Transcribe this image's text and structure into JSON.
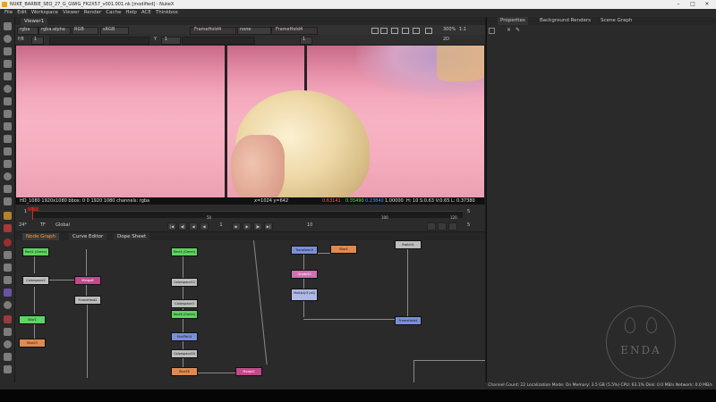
{
  "window": {
    "title": "NUKE_BARBIE_SEQ_27_G_GWIG_FK2X57_v001.001.nk [modified] - NukeX",
    "minimize_glyph": "–",
    "maximize_glyph": "□",
    "close_glyph": "×"
  },
  "menu": [
    "File",
    "Edit",
    "Workspace",
    "Viewer",
    "Render",
    "Cache",
    "Help",
    "ACE",
    "Thinkbox"
  ],
  "viewer": {
    "tab_label": "Viewer1",
    "channel": "rgba",
    "layer": "rgba.alpha",
    "color_mode": "RGB",
    "colorspace": "sRGB",
    "input_a": "FrameHold4",
    "input_label": "none",
    "input_b": "FrameHold4",
    "zoom": "300%",
    "ratio": "1:1",
    "view_mode": "2D",
    "frame_fraction": "f/8",
    "y_label": "Y",
    "y_value": "1",
    "gain_label": "1",
    "gamma_label": "1"
  },
  "info_bar": {
    "format": "HD_1080 1920x1080  bbox: 0 0 1920 1080  channels: rgba",
    "coords": "x=1024 y=642",
    "r": "0.63141",
    "g": "0.35490",
    "b": "0.23840",
    "a": "1.00000",
    "hsvl": "H: 10 S:0.63 V:0.65  L: 0.37380"
  },
  "timeline": {
    "start": "1",
    "end": "120",
    "tick_50": "50",
    "tick_100": "100",
    "current": "1",
    "fps": "24*",
    "tf": "TF",
    "scope": "Global",
    "step": "10",
    "right_frame": "5",
    "right_frame_b": "5"
  },
  "graph_tabs": [
    "Node Graph",
    "Curve Editor",
    "Dope Sheet"
  ],
  "nodes": [
    {
      "name": "Rect1 (Green)",
      "color": "green"
    },
    {
      "name": "Colorspace2",
      "color": "grey"
    },
    {
      "name": "Merge8",
      "color": "pink"
    },
    {
      "name": "FrameHold2",
      "color": "grey"
    },
    {
      "name": "Blur1",
      "color": "green"
    },
    {
      "name": "Blur23",
      "color": "orange"
    },
    {
      "name": "Rect4 (Green)",
      "color": "green"
    },
    {
      "name": "Colorspace12",
      "color": "grey"
    },
    {
      "name": "Colorspace3",
      "color": "grey"
    },
    {
      "name": "Rect6 (Green)",
      "color": "green"
    },
    {
      "name": "Shuffle14",
      "color": "blue"
    },
    {
      "name": "Colorspace20",
      "color": "grey"
    },
    {
      "name": "Blur26",
      "color": "orange"
    },
    {
      "name": "Merge2",
      "color": "pink"
    },
    {
      "name": "Transform9",
      "color": "blue"
    },
    {
      "name": "Blur4",
      "color": "orange"
    },
    {
      "name": "Grade20",
      "color": "pinkl"
    },
    {
      "name": "Multiply3 (all)",
      "color": "lav"
    },
    {
      "name": "Switch1",
      "color": "grey"
    },
    {
      "name": "FrameHold4",
      "color": "blue"
    }
  ],
  "right_panel": {
    "tabs": [
      "Properties",
      "Background Renders",
      "Scene Graph"
    ],
    "tool_icons": [
      "pin-icon",
      "close-all-icon",
      "edit-icon"
    ]
  },
  "watermark": "ENDA",
  "status": "Channel Count: 22  Localization Mode: On  Memory: 3.5 GB (5.5%)  CPU: 63.1%  Disk: 0.0 MB/s  Network: 0.0 MB/s"
}
